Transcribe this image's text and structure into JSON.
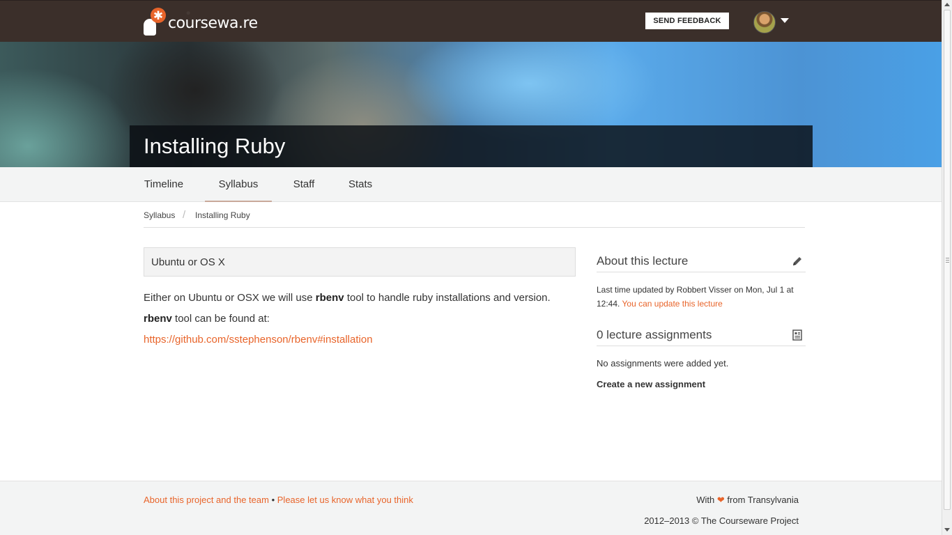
{
  "header": {
    "logo_text": "coursewa.re",
    "feedback_label": "SEND FEEDBACK"
  },
  "hero": {
    "title": "Installing Ruby"
  },
  "tabs": [
    {
      "label": "Timeline"
    },
    {
      "label": "Syllabus",
      "active": true
    },
    {
      "label": "Staff"
    },
    {
      "label": "Stats"
    }
  ],
  "breadcrumb": {
    "items": [
      "Syllabus",
      "Installing Ruby"
    ],
    "separator": "/"
  },
  "content": {
    "section_title": "Ubuntu or OS X",
    "para1_pre": "Either on Ubuntu or OSX we will use ",
    "para1_bold": "rbenv",
    "para1_post": " tool to handle ruby installations and version.",
    "para2_bold": "rbenv",
    "para2_post": " tool can be found at:",
    "link": "https://github.com/sstephenson/rbenv#installation"
  },
  "sidebar": {
    "about_title": "About this lecture",
    "updated_text": "Last time updated by Robbert Visser on Mon, Jul 1 at",
    "updated_time": "12:44.",
    "update_link": "You can update this lecture",
    "assignments_title": "0 lecture assignments",
    "no_assignments": "No assignments were added yet.",
    "create_link": "Create a new assignment"
  },
  "footer": {
    "about_link": "About this project and the team",
    "bullet": "•",
    "feedback_link": "Please let us know what you think",
    "with_text": "With",
    "from_text": "from Transylvania",
    "copyright": "2012–2013 © The Courseware Project"
  },
  "colors": {
    "accent": "#e8642a",
    "topbar": "#3b2f2a"
  },
  "icons": [
    "logo-icon",
    "avatar",
    "caret-down-icon",
    "pencil-icon",
    "document-icon",
    "heart-icon"
  ]
}
